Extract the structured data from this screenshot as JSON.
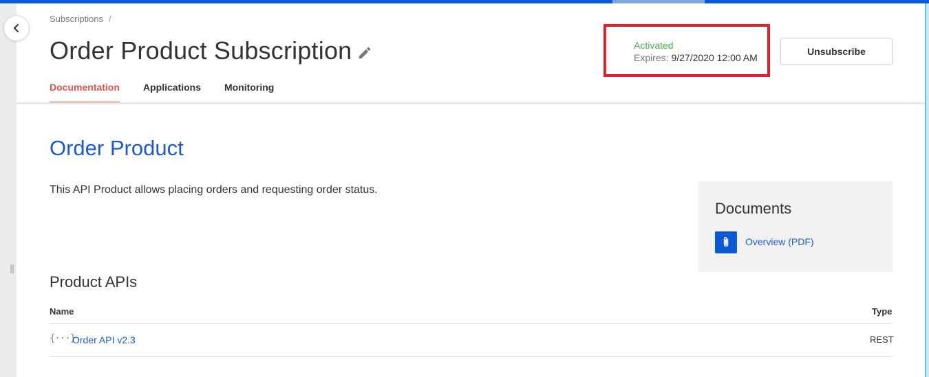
{
  "breadcrumb": {
    "item": "Subscriptions",
    "separator": "/"
  },
  "header": {
    "title": "Order Product Subscription"
  },
  "status": {
    "state": "Activated",
    "expires_label": "Expires:",
    "expires_value": "9/27/2020 12:00 AM"
  },
  "actions": {
    "unsubscribe_label": "Unsubscribe"
  },
  "tabs": [
    {
      "label": "Documentation",
      "active": true
    },
    {
      "label": "Applications",
      "active": false
    },
    {
      "label": "Monitoring",
      "active": false
    }
  ],
  "product": {
    "title": "Order Product",
    "description": "This API Product allows placing orders and requesting order status."
  },
  "documents": {
    "title": "Documents",
    "items": [
      {
        "label": "Overview (PDF)",
        "icon": "paperclip-icon"
      }
    ]
  },
  "apis": {
    "title": "Product APIs",
    "columns": {
      "name": "Name",
      "type": "Type"
    },
    "rows": [
      {
        "name": "Order API v2.3",
        "type": "REST",
        "icon_text": "{···}"
      }
    ]
  },
  "colors": {
    "accent": "#0a5bd3",
    "active_tab": "#d9534f",
    "status_ok": "#4caf50",
    "highlight_box": "#e0202c",
    "link": "#1e5bc6"
  }
}
